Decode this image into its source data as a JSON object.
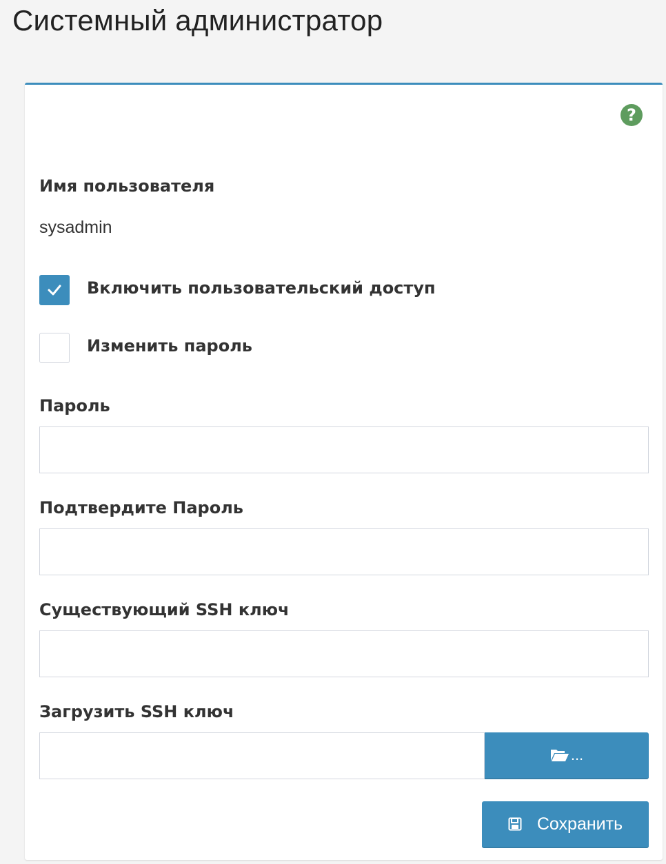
{
  "page": {
    "title": "Системный администратор"
  },
  "form": {
    "help_icon": "question-circle-icon",
    "username_label": "Имя пользователя",
    "username_value": "sysadmin",
    "enable_access": {
      "label": "Включить пользовательский доступ",
      "checked": true
    },
    "change_password": {
      "label": "Изменить пароль",
      "checked": false
    },
    "password_label": "Пароль",
    "password_value": "",
    "confirm_password_label": "Подтвердите Пароль",
    "confirm_password_value": "",
    "existing_ssh_key_label": "Существующий SSH ключ",
    "existing_ssh_key_value": "",
    "upload_ssh_key_label": "Загрузить SSH ключ",
    "upload_ssh_key_value": "",
    "browse_button_text": "...",
    "browse_icon": "folder-open-icon",
    "save_button_label": "Сохранить",
    "save_icon": "floppy-disk-icon"
  },
  "colors": {
    "accent": "#3c8dbc",
    "help": "#5e9c5e",
    "background": "#f4f4f4"
  }
}
